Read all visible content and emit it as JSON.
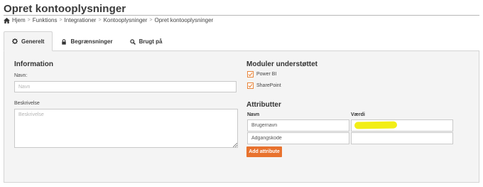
{
  "page": {
    "title": "Opret kontooplysninger"
  },
  "breadcrumb": [
    "Hjem",
    "Funktions",
    "Integrationer",
    "Kontooplysninger",
    "Opret kontooplysninger"
  ],
  "tabs": [
    {
      "label": "Generelt",
      "icon": "gear-icon",
      "active": true
    },
    {
      "label": "Begrænsninger",
      "icon": "lock-icon",
      "active": false
    },
    {
      "label": "Brugt på",
      "icon": "search-icon",
      "active": false
    }
  ],
  "information": {
    "title": "Information",
    "name_label": "Navn:",
    "name_placeholder": "Navn",
    "name_value": "",
    "description_label": "Beskrivelse",
    "description_placeholder": "Beskrivelse",
    "description_value": ""
  },
  "modules": {
    "title": "Moduler understøttet",
    "items": [
      {
        "label": "Power BI",
        "checked": true
      },
      {
        "label": "SharePoint",
        "checked": true
      }
    ]
  },
  "attributes": {
    "title": "Attributter",
    "name_header": "Navn",
    "value_header": "Værdi",
    "rows": [
      {
        "name": "Brugernavn",
        "value": ""
      },
      {
        "name": "Adgangskode",
        "value": ""
      }
    ],
    "add_label": "Add attribute"
  },
  "colors": {
    "accent": "#e8722e",
    "checkbox_border": "#e8853b",
    "highlight": "#f2ee16",
    "panel_bg": "#f4f4f4"
  }
}
